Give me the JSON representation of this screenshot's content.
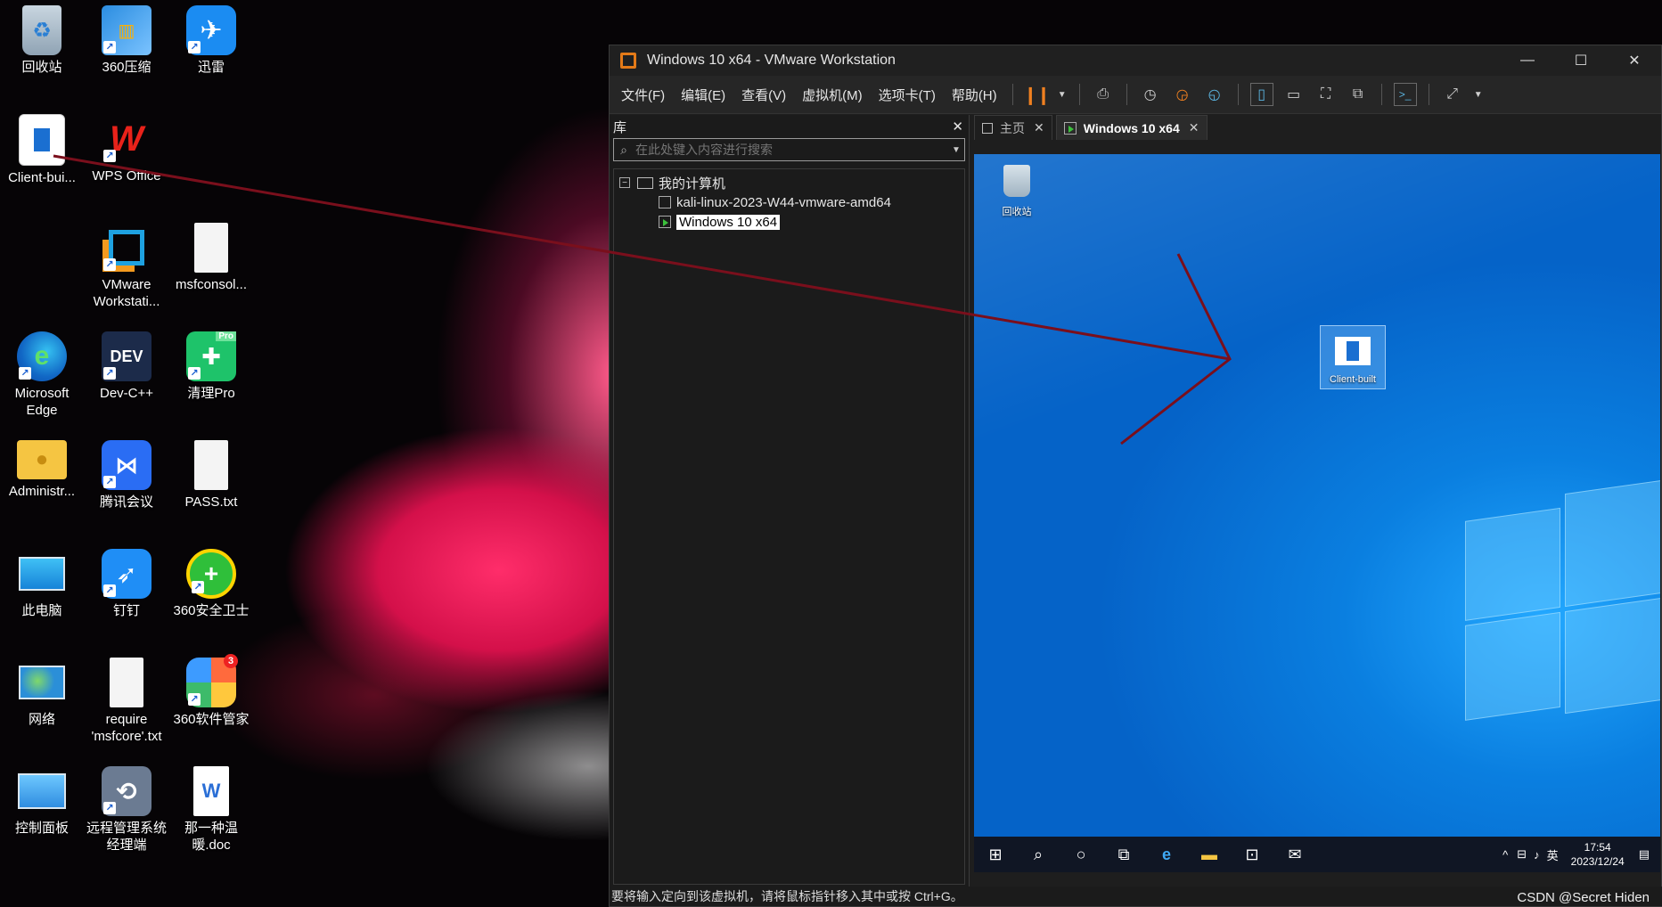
{
  "host_desktop": {
    "icons": [
      {
        "label": "回收站",
        "icon": "recycle-bin-icon"
      },
      {
        "label": "360压缩",
        "icon": "archive-icon"
      },
      {
        "label": "迅雷",
        "icon": "bird-icon"
      },
      {
        "label": "Client-bui...",
        "icon": "document-icon"
      },
      {
        "label": "WPS Office",
        "icon": "wps-icon"
      },
      {
        "label": "VMware Workstati...",
        "icon": "vmware-icon"
      },
      {
        "label": "msfconsol...",
        "icon": "file-icon"
      },
      {
        "label": "Microsoft Edge",
        "icon": "edge-icon"
      },
      {
        "label": "Dev-C++",
        "icon": "devcpp-icon"
      },
      {
        "label": "清理Pro",
        "icon": "cleaner-icon"
      },
      {
        "label": "Administr...",
        "icon": "user-folder-icon"
      },
      {
        "label": "腾讯会议",
        "icon": "meeting-icon"
      },
      {
        "label": "PASS.txt",
        "icon": "text-file-icon"
      },
      {
        "label": "此电脑",
        "icon": "monitor-icon"
      },
      {
        "label": "钉钉",
        "icon": "dingtalk-icon"
      },
      {
        "label": "360安全卫士",
        "icon": "shield-plus-icon"
      },
      {
        "label": "网络",
        "icon": "network-icon"
      },
      {
        "label": "require 'msfcore'.txt",
        "icon": "text-file-icon"
      },
      {
        "label": "360软件管家",
        "icon": "software-manager-icon"
      },
      {
        "label": "控制面板",
        "icon": "control-panel-icon"
      },
      {
        "label": "远程管理系统经理端",
        "icon": "remote-icon"
      },
      {
        "label": "那一种温暖.doc",
        "icon": "word-doc-icon"
      }
    ],
    "badge_360_manager": "3",
    "devcpp_text": "DEV",
    "cleaner_pro_badge": "Pro"
  },
  "vmware": {
    "title": "Windows 10 x64 - VMware Workstation",
    "menu": [
      "文件(F)",
      "编辑(E)",
      "查看(V)",
      "虚拟机(M)",
      "选项卡(T)",
      "帮助(H)"
    ],
    "library": {
      "title": "库",
      "search_placeholder": "在此处键入内容进行搜索",
      "root": "我的计算机",
      "vms": [
        "kali-linux-2023-W44-vmware-amd64",
        "Windows 10 x64"
      ],
      "selected_vm": "Windows 10 x64"
    },
    "tabs": [
      {
        "label": "主页"
      },
      {
        "label": "Windows 10 x64"
      }
    ],
    "status_text": "要将输入定向到该虚拟机，请将鼠标指针移入其中或按 Ctrl+G。",
    "accent_color": "#e37a18"
  },
  "guest": {
    "icons": [
      {
        "label": "回收站"
      },
      {
        "label": "Client-built"
      }
    ],
    "clock_time": "17:54",
    "clock_date": "2023/12/24",
    "ime": "英",
    "background_color": "#0a7fe0"
  },
  "annotation_color": "#7a0f1c",
  "watermark": "CSDN @Secret Hiden"
}
